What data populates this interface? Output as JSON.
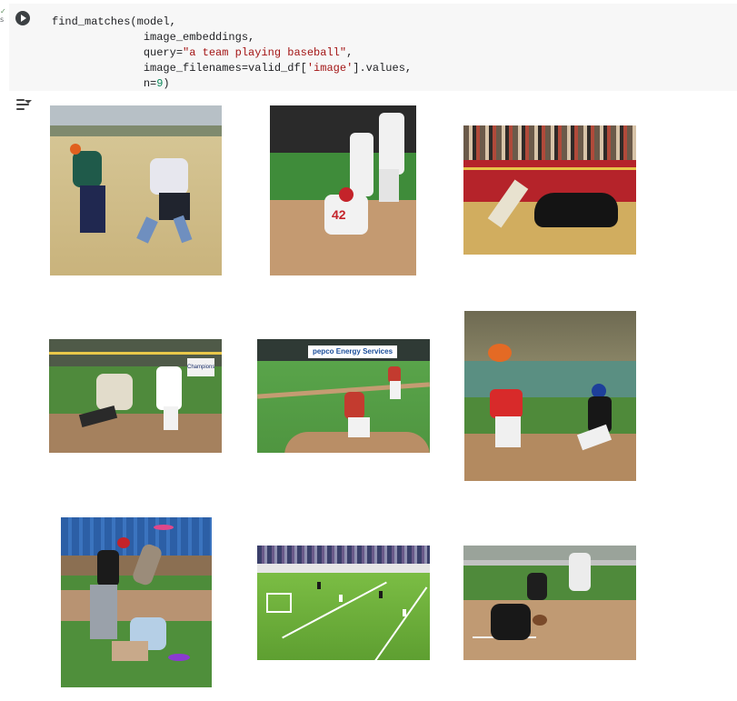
{
  "cell": {
    "status_mark": "✓",
    "status_sub": "s",
    "code_lines": [
      [
        "find_matches(model,",
        ""
      ],
      [
        "              image_embeddings,",
        ""
      ],
      [
        "              query=",
        "\"a team playing baseball\"",
        ","
      ],
      [
        "              image_filenames=valid_df[",
        "'image'",
        "].values,"
      ],
      [
        "              n=",
        "9",
        ")"
      ]
    ]
  },
  "output": {
    "images": [
      {
        "subject": "frisbee-players-field"
      },
      {
        "subject": "baseball-slide-at-base"
      },
      {
        "subject": "bullfighter-arena"
      },
      {
        "subject": "softball-tag-at-base"
      },
      {
        "subject": "baseball-pitcher-field"
      },
      {
        "subject": "youth-baseball-slide"
      },
      {
        "subject": "dog-frisbee-catch"
      },
      {
        "subject": "soccer-stadium-aerial"
      },
      {
        "subject": "softball-batter-catcher"
      }
    ],
    "banner_text": "pepco Energy Services",
    "sign_text": "Champions",
    "jersey_number": "42"
  },
  "colors": {
    "cell_bg": "#f7f7f7",
    "run_button": "#3c4043",
    "string": "#a31515",
    "number": "#098658",
    "status_green": "#5f8f5f"
  }
}
